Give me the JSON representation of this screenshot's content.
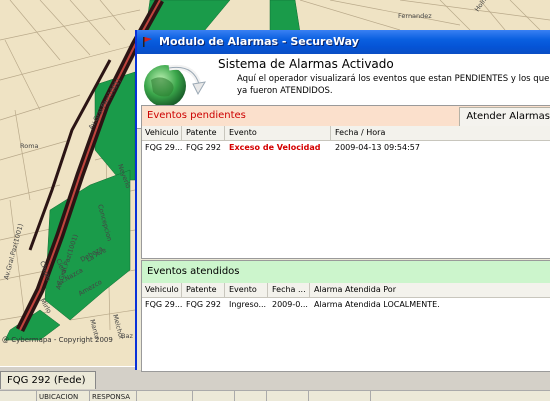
{
  "map": {
    "labels": [
      "Roma",
      "Av.Gral.Paz(1001)",
      "Av.Gral.Paz(1001)",
      "Neyerlo",
      "Concepcion",
      "Av.Gral.Paz(1001)",
      "Cielo",
      "La Ave",
      "Av.Nazca",
      "Amezco",
      "Mirlo",
      "Chupo",
      "Manto",
      "Melchor",
      "Baz",
      "Holmbe",
      "Fernandez",
      "Deheza"
    ],
    "copyright": "@ Cybermapa - Copyright 2009",
    "colors": {
      "land": "#efe3c4",
      "park": "#1a9b4a",
      "road_dark": "#2b1414",
      "road_red": "#c0443d"
    }
  },
  "bottom": {
    "vehicle_tab": "FQG 292 (Fede)",
    "headers": [
      "",
      "UBICACION",
      "RESPONSA",
      "",
      "",
      "",
      "",
      ""
    ]
  },
  "window": {
    "title": "Modulo de Alarmas - SecureWay",
    "banner_title": "Sistema de Alarmas Activado",
    "banner_desc": "Aquí el operador visualizará los eventos que estan PENDIENTES y los que ya fueron ATENDIDOS."
  },
  "pendientes": {
    "title": "Eventos pendientes",
    "button": "Atender Alarmas",
    "columns": [
      "Vehiculo",
      "Patente",
      "Evento",
      "Fecha / Hora"
    ],
    "rows": [
      {
        "vehiculo": "FQG 29...",
        "patente": "FQG 292",
        "evento": "Exceso de Velocidad",
        "fecha": "2009-04-13 09:54:57"
      }
    ]
  },
  "atendidos": {
    "title": "Eventos atendidos",
    "columns": [
      "Vehiculo",
      "Patente",
      "Evento",
      "Fecha ...",
      "Alarma Atendida Por"
    ],
    "rows": [
      {
        "vehiculo": "FQG 29...",
        "patente": "FQG 292",
        "evento": "Ingreso...",
        "fecha": "2009-0...",
        "atendida": "Alarma Atendida LOCALMENTE."
      }
    ]
  }
}
